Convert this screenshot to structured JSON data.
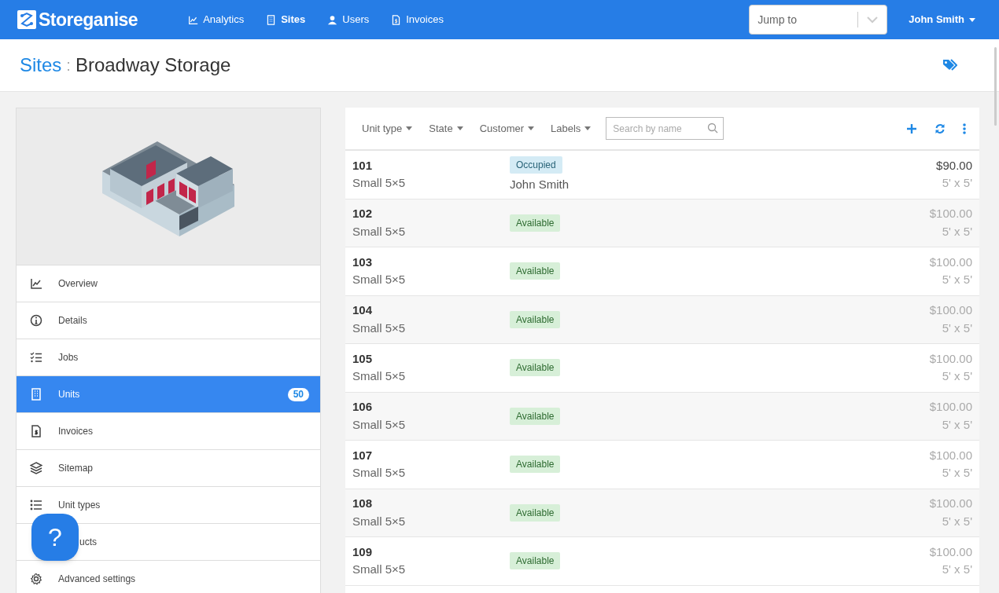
{
  "navbar": {
    "brand": "Storeganise",
    "links": [
      {
        "label": "Analytics",
        "kind": "chart",
        "selected": false
      },
      {
        "label": "Sites",
        "kind": "building",
        "selected": true
      },
      {
        "label": "Users",
        "kind": "user",
        "selected": false
      },
      {
        "label": "Invoices",
        "kind": "invoice",
        "selected": false
      }
    ],
    "jump_to": {
      "placeholder": "Jump to"
    },
    "user_menu": "John Smith"
  },
  "header": {
    "breadcrumb": "Sites",
    "separator": ":",
    "title": "Broadway Storage"
  },
  "sidebar": {
    "items": [
      {
        "label": "Overview",
        "kind": "chart",
        "selected": false
      },
      {
        "label": "Details",
        "kind": "info",
        "selected": false
      },
      {
        "label": "Jobs",
        "kind": "tasks",
        "selected": false
      },
      {
        "label": "Units",
        "kind": "building",
        "selected": true,
        "badge": "50"
      },
      {
        "label": "Invoices",
        "kind": "invoice",
        "selected": false
      },
      {
        "label": "Sitemap",
        "kind": "layers",
        "selected": false
      },
      {
        "label": "Unit types",
        "kind": "list",
        "selected": false
      },
      {
        "label": "ucts",
        "kind": "covered",
        "selected": false
      },
      {
        "label": "Advanced settings",
        "kind": "gear",
        "selected": false
      }
    ]
  },
  "help_button": "?",
  "toolbar": {
    "filters": [
      "Unit type",
      "State",
      "Customer",
      "Labels"
    ],
    "search": {
      "placeholder": "Search by name"
    }
  },
  "units": [
    {
      "number": "101",
      "type": "Small 5×5",
      "state": {
        "kind": "occupied",
        "label": "Occupied"
      },
      "customer": "John Smith",
      "price": "$90.00",
      "size": "5' x 5'"
    },
    {
      "number": "102",
      "type": "Small 5×5",
      "state": {
        "kind": "available",
        "label": "Available"
      },
      "price": "$100.00",
      "size": "5' x 5'"
    },
    {
      "number": "103",
      "type": "Small 5×5",
      "state": {
        "kind": "available",
        "label": "Available"
      },
      "price": "$100.00",
      "size": "5' x 5'"
    },
    {
      "number": "104",
      "type": "Small 5×5",
      "state": {
        "kind": "available",
        "label": "Available"
      },
      "price": "$100.00",
      "size": "5' x 5'"
    },
    {
      "number": "105",
      "type": "Small 5×5",
      "state": {
        "kind": "available",
        "label": "Available"
      },
      "price": "$100.00",
      "size": "5' x 5'"
    },
    {
      "number": "106",
      "type": "Small 5×5",
      "state": {
        "kind": "available",
        "label": "Available"
      },
      "price": "$100.00",
      "size": "5' x 5'"
    },
    {
      "number": "107",
      "type": "Small 5×5",
      "state": {
        "kind": "available",
        "label": "Available"
      },
      "price": "$100.00",
      "size": "5' x 5'"
    },
    {
      "number": "108",
      "type": "Small 5×5",
      "state": {
        "kind": "available",
        "label": "Available"
      },
      "price": "$100.00",
      "size": "5' x 5'"
    },
    {
      "number": "109",
      "type": "Small 5×5",
      "state": {
        "kind": "available",
        "label": "Available"
      },
      "price": "$100.00",
      "size": "5' x 5'"
    }
  ]
}
